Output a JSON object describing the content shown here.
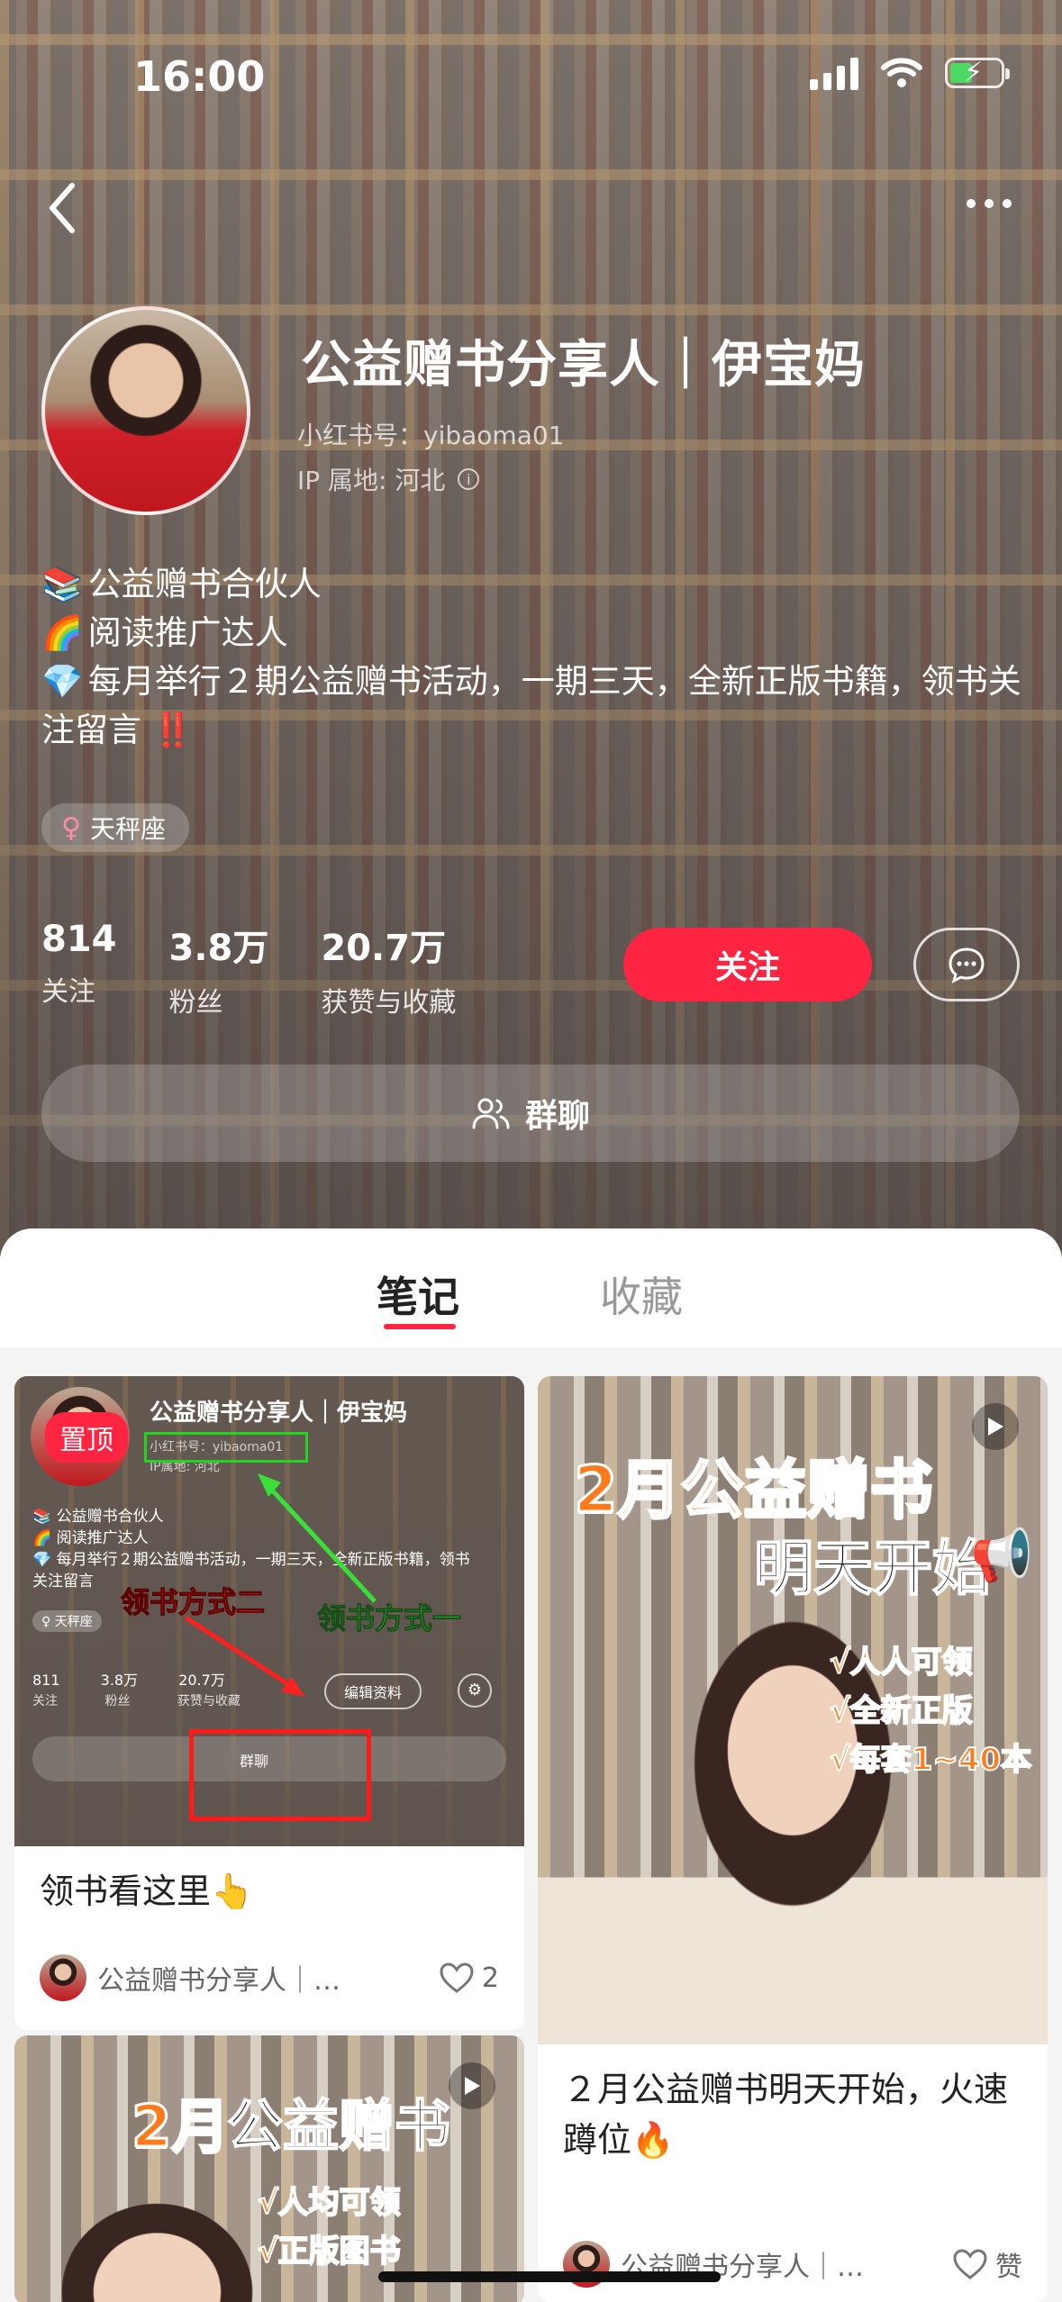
{
  "status_bar": {
    "time": "16:00"
  },
  "profile": {
    "name": "公益赠书分享人｜伊宝妈",
    "red_id": "小红书号：yibaoma01",
    "ip": "IP 属地: 河北",
    "bio": [
      {
        "icon": "📚",
        "text": "公益赠书合伙人"
      },
      {
        "icon": "🌈",
        "text": "阅读推广达人"
      },
      {
        "icon": "💎",
        "text": "每月举行２期公益赠书活动，一期三天，全新正版书籍，领书关注留言"
      }
    ],
    "bio_end_icon": "‼️",
    "tag": "天秤座",
    "stats": [
      {
        "num": "814",
        "label": "关注"
      },
      {
        "num": "3.8万",
        "label": "粉丝"
      },
      {
        "num": "20.7万",
        "label": "获赞与收藏"
      }
    ],
    "follow_label": "关注",
    "group_chat_label": "群聊"
  },
  "tabs": {
    "active": "笔记",
    "inactive": "收藏"
  },
  "notes": [
    {
      "title": "领书看这里",
      "title_emoji": "👆",
      "author": "公益赠书分享人｜…",
      "likes": "2",
      "pin_badge": "置顶",
      "preview": {
        "name": "公益赠书分享人｜伊宝妈",
        "red_id": "小红书号：yibaoma01",
        "ip": "IP属地: 河北",
        "bio1": "📚 公益赠书合伙人",
        "bio2": "🌈 阅读推广达人",
        "bio3": "💎 每月举行２期公益赠书活动，一期三天，全新正版书籍，领书",
        "bio4": "关注留言",
        "tag": "♀ 天秤座",
        "stats": [
          {
            "num": "811",
            "label": "关注"
          },
          {
            "num": "3.8万",
            "label": "粉丝"
          },
          {
            "num": "20.7万",
            "label": "获赞与收藏"
          }
        ],
        "edit_label": "编辑资料",
        "group_label": "群聊",
        "annotation_one": "领书方式一",
        "annotation_two": "领书方式二"
      }
    },
    {
      "title": "２月公益赠书明天开始，火速蹲位",
      "title_emoji": "🔥",
      "author": "公益赠书分享人｜…",
      "likes": "赞",
      "overlay": {
        "line1": "2月公益赠书",
        "line2": "明天开始",
        "megaphone": "📢",
        "checks": [
          "√人人可领",
          "√全新正版",
          "√每套1~40本"
        ]
      }
    },
    {
      "overlay": {
        "line1_a": "2月",
        "line1_b": "公益赠书",
        "checks": [
          "√人均可领",
          "√正版图书"
        ]
      }
    }
  ],
  "colors": {
    "accent": "#ff2442",
    "overlay_orange": "#ff7a1a"
  }
}
